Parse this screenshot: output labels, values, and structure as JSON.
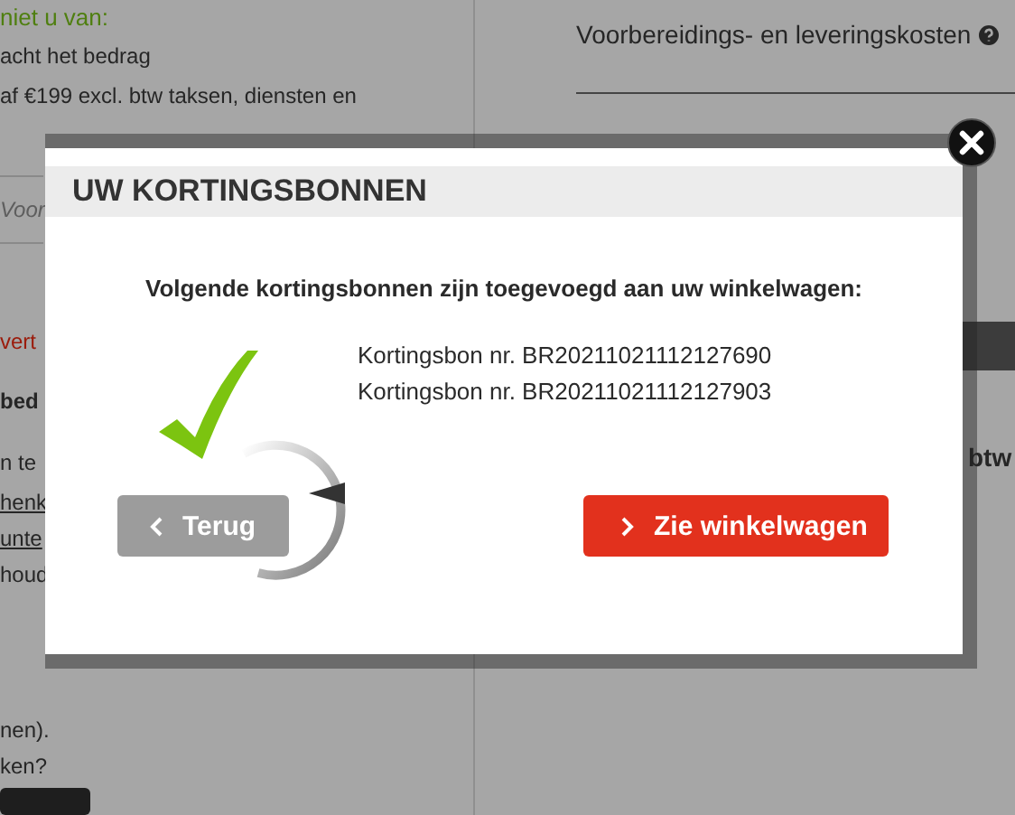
{
  "page": {
    "left_lines": [
      {
        "kind": "heading",
        "text": "niet u van:"
      },
      {
        "kind": "plain",
        "text": "acht het bedrag"
      },
      {
        "kind": "plain",
        "text": "af €199 excl. btw taksen, diensten en"
      },
      {
        "kind": "field",
        "text": "Voor"
      },
      {
        "kind": "alert",
        "text": "vert"
      },
      {
        "kind": "bold",
        "text": "bed"
      },
      {
        "kind": "plain",
        "text": "n te"
      },
      {
        "kind": "link",
        "text": "henk"
      },
      {
        "kind": "link",
        "text": "unte"
      },
      {
        "kind": "plain",
        "text": "houd"
      },
      {
        "kind": "plain",
        "text": "nen)."
      },
      {
        "kind": "plain",
        "text": "ken?"
      },
      {
        "kind": "button"
      }
    ],
    "right": {
      "title": "Voorbereidings- en leveringskosten",
      "side_text": "btw"
    }
  },
  "modal": {
    "title": "UW KORTINGSBONNEN",
    "message": "Volgende kortingsbonnen zijn toegevoegd aan uw winkelwagen:",
    "coupons": [
      "Kortingsbon nr. BR20211021112127690",
      "Kortingsbon nr. BR20211021112127903"
    ],
    "buttons": [
      {
        "kind": "back",
        "label": "Terug"
      },
      {
        "kind": "primary",
        "label": "Zie winkelwagen"
      }
    ]
  }
}
